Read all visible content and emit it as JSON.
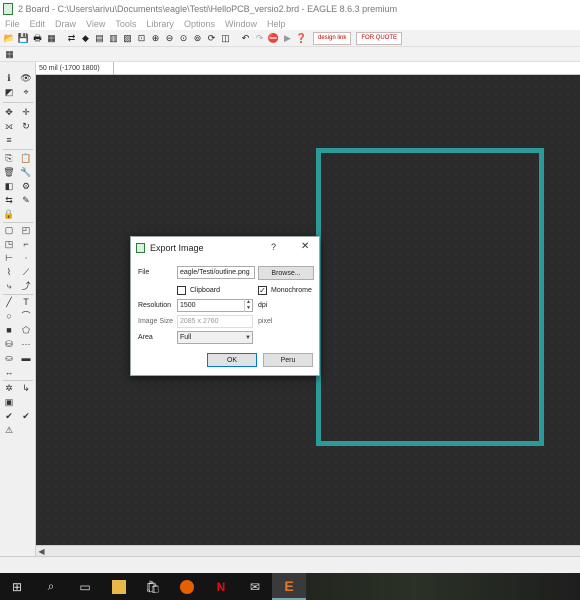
{
  "window": {
    "title": "2 Board - C:\\Users\\arivu\\Documents\\eagle\\Testi\\HelloPCB_versio2.brd - EAGLE 8.6.3 premium"
  },
  "menu": [
    "File",
    "Edit",
    "Draw",
    "View",
    "Tools",
    "Library",
    "Options",
    "Window",
    "Help"
  ],
  "toolbar": {
    "design_link_label": "design link",
    "for_quote_label": "FOR QUOTE"
  },
  "coord": {
    "readout": "50 mil (-1700 1800)"
  },
  "dialog": {
    "title": "Export Image",
    "help": "?",
    "close": "✕",
    "file_label": "File",
    "file_value": "eagle/Testi/outline.png",
    "browse_label": "Browse...",
    "clipboard_label": "Clipboard",
    "clipboard_checked": false,
    "monochrome_label": "Monochrome",
    "monochrome_checked": true,
    "monochrome_check": "✓",
    "resolution_label": "Resolution",
    "resolution_value": "1500",
    "dpi_label": "dpi",
    "image_size_label": "Image Size",
    "image_size_value": "2085 x 2760",
    "pixel_label": "pixel",
    "area_label": "Area",
    "area_value": "Full",
    "ok_label": "OK",
    "cancel_label": "Peru"
  },
  "taskbar": {
    "icons": [
      "windows-logo",
      "search",
      "task-view",
      "file-explorer",
      "store",
      "firefox",
      "netflix",
      "mail",
      "eagle"
    ]
  },
  "colors": {
    "canvas": "#2b2b2b",
    "board_outline": "#2d9a9a",
    "taskbar": "#141414"
  }
}
